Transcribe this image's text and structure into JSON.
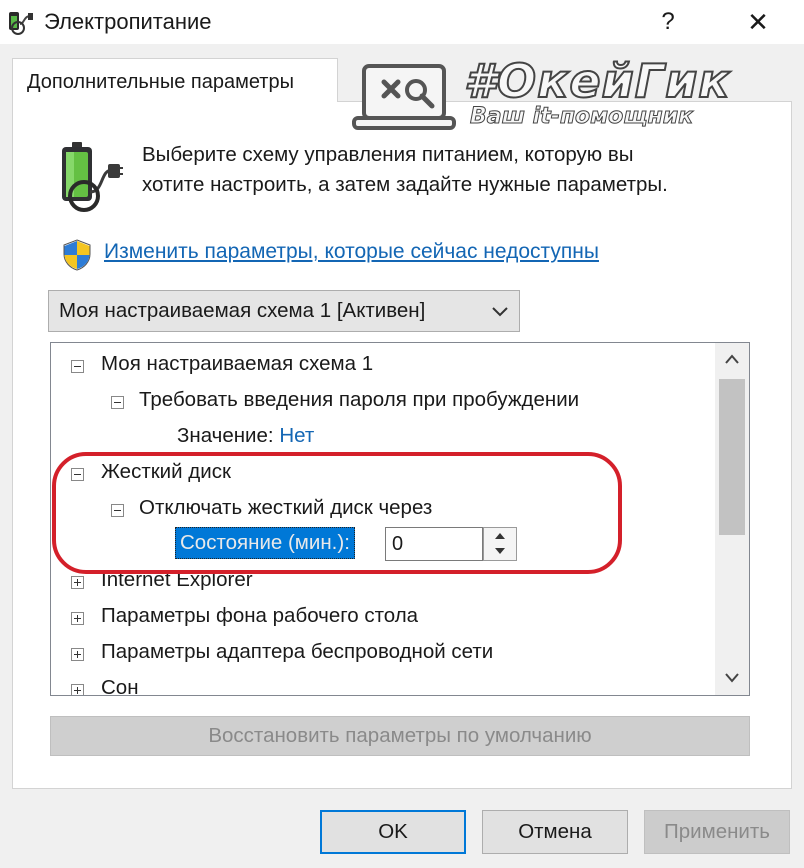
{
  "window": {
    "title": "Электропитание",
    "help_glyph": "?",
    "close_glyph": "✕"
  },
  "tabs": [
    {
      "label": "Дополнительные параметры",
      "active": true
    }
  ],
  "watermark": {
    "title": "#ОкейГик",
    "subtitle": "Ваш it-помощник"
  },
  "description": {
    "line1": "Выберите схему управления питанием, которую вы",
    "line2": "хотите настроить, а затем задайте нужные параметры."
  },
  "uac_link": {
    "text": "Изменить параметры, которые сейчас недоступны"
  },
  "scheme_select": {
    "selected": "Моя настраиваемая схема 1 [Активен]"
  },
  "tree": {
    "items": [
      {
        "label": "Моя настраиваемая схема 1",
        "state": "expanded"
      },
      {
        "label": "Требовать введения пароля при пробуждении",
        "state": "expanded"
      },
      {
        "label": "Значение:",
        "value": "Нет"
      },
      {
        "label": "Жесткий диск",
        "state": "expanded"
      },
      {
        "label": "Отключать жесткий диск через",
        "state": "expanded"
      },
      {
        "label": "Состояние (мин.):",
        "value": "0"
      },
      {
        "label": "Internet Explorer",
        "state": "collapsed"
      },
      {
        "label": "Параметры фона рабочего стола",
        "state": "collapsed"
      },
      {
        "label": "Параметры адаптера беспроводной сети",
        "state": "collapsed"
      },
      {
        "label": "Сон",
        "state": "collapsed"
      }
    ]
  },
  "buttons": {
    "restore": "Восстановить параметры по умолчанию",
    "ok": "OK",
    "cancel": "Отмена",
    "apply": "Применить"
  },
  "colors": {
    "accent": "#0078d7",
    "link": "#1366b4",
    "highlight_ring": "#d4202a"
  },
  "icons": [
    "power-options-icon",
    "battery-plug-icon",
    "uac-shield-icon",
    "chevron-down-icon",
    "scroll-up-icon",
    "scroll-down-icon",
    "spin-up-icon",
    "spin-down-icon",
    "laptop-tools-icon"
  ]
}
